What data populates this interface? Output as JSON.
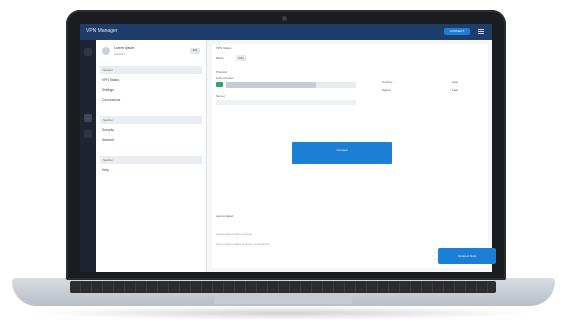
{
  "app": {
    "title": "VPN Manager",
    "account_button": "CONNECT"
  },
  "side": {
    "user_name": "Lorem Ipsum",
    "user_role": "Account",
    "user_button": "Edit",
    "sections": [
      {
        "label": "Section"
      },
      {
        "label": "Section"
      },
      {
        "label": "Section"
      }
    ],
    "items": [
      {
        "label": "VPN Status"
      },
      {
        "label": "Settings"
      },
      {
        "label": "Connections"
      },
      {
        "label": "Security"
      },
      {
        "label": "Network"
      },
      {
        "label": "Help"
      }
    ]
  },
  "main": {
    "status_label": "VPN Status",
    "mode_label": "Mode",
    "mode_value": "Auto",
    "protocol_label": "Protocol",
    "auto_label": "Auto-connect",
    "server_label": "Server",
    "right_label_1": "Country",
    "right_label_2": "Speed",
    "right_value_1": "Auto",
    "right_value_2": "Fast",
    "primary_button": "Connect",
    "footer_1": "Last updated",
    "footer_2": "Lorem ipsum dolor sit amet",
    "footer_3": "Lorem ipsum dolor sit amet, consectetur",
    "float_button": "Connect Now"
  },
  "colors": {
    "accent": "#1c7fd6",
    "appbar": "#1e3d6b",
    "toggle_on": "#2aa676"
  }
}
